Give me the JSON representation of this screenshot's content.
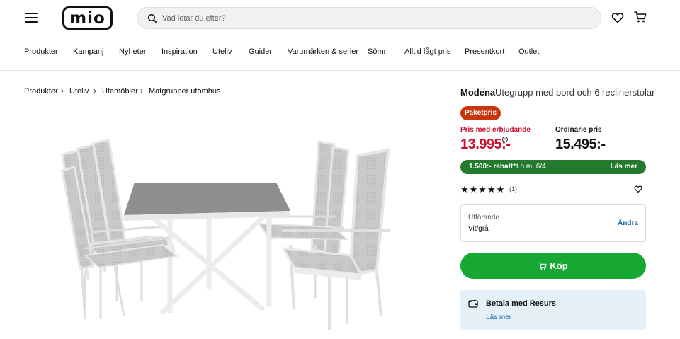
{
  "header": {
    "logo_text": "mio",
    "search_placeholder": "Vad letar du efter?"
  },
  "nav": {
    "items": [
      "Produkter",
      "Kampanj",
      "Nyheter",
      "Inspiration",
      "Uteliv",
      "Guider",
      "Varumärken & serier",
      "Sömn",
      "Alltid lågt pris",
      "Presentkort",
      "Outlet"
    ]
  },
  "breadcrumb": [
    "Produkter",
    "Uteliv",
    "Utemöbler",
    "Matgrupper utomhus"
  ],
  "product": {
    "brand": "Modena",
    "name": "Utegrupp med bord och 6 reclinerstolar",
    "badge": "Paketpris",
    "offer_label": "Pris med erbjudande",
    "offer_price": "13.995:-",
    "ordinary_label": "Ordinarie pris",
    "ordinary_price": "15.495:-",
    "promo_discount": "1.500:- rabatt*",
    "promo_until": "t.o.m. 6/4",
    "promo_link": "Läs mer",
    "rating_stars": "★★★★★",
    "review_count": "(1)",
    "variant_label": "Utförande",
    "variant_value": "Vit/grå",
    "variant_change": "Ändra",
    "buy_label": "Köp",
    "payment_title": "Betala med Resurs",
    "payment_link": "Läs mer"
  },
  "colors": {
    "badge": "#c8360e",
    "offer_price": "#c8102e",
    "promo_bar": "#237a2c",
    "buy_button": "#17a733",
    "link": "#1565a8",
    "payment_box": "#e6f0f9"
  }
}
